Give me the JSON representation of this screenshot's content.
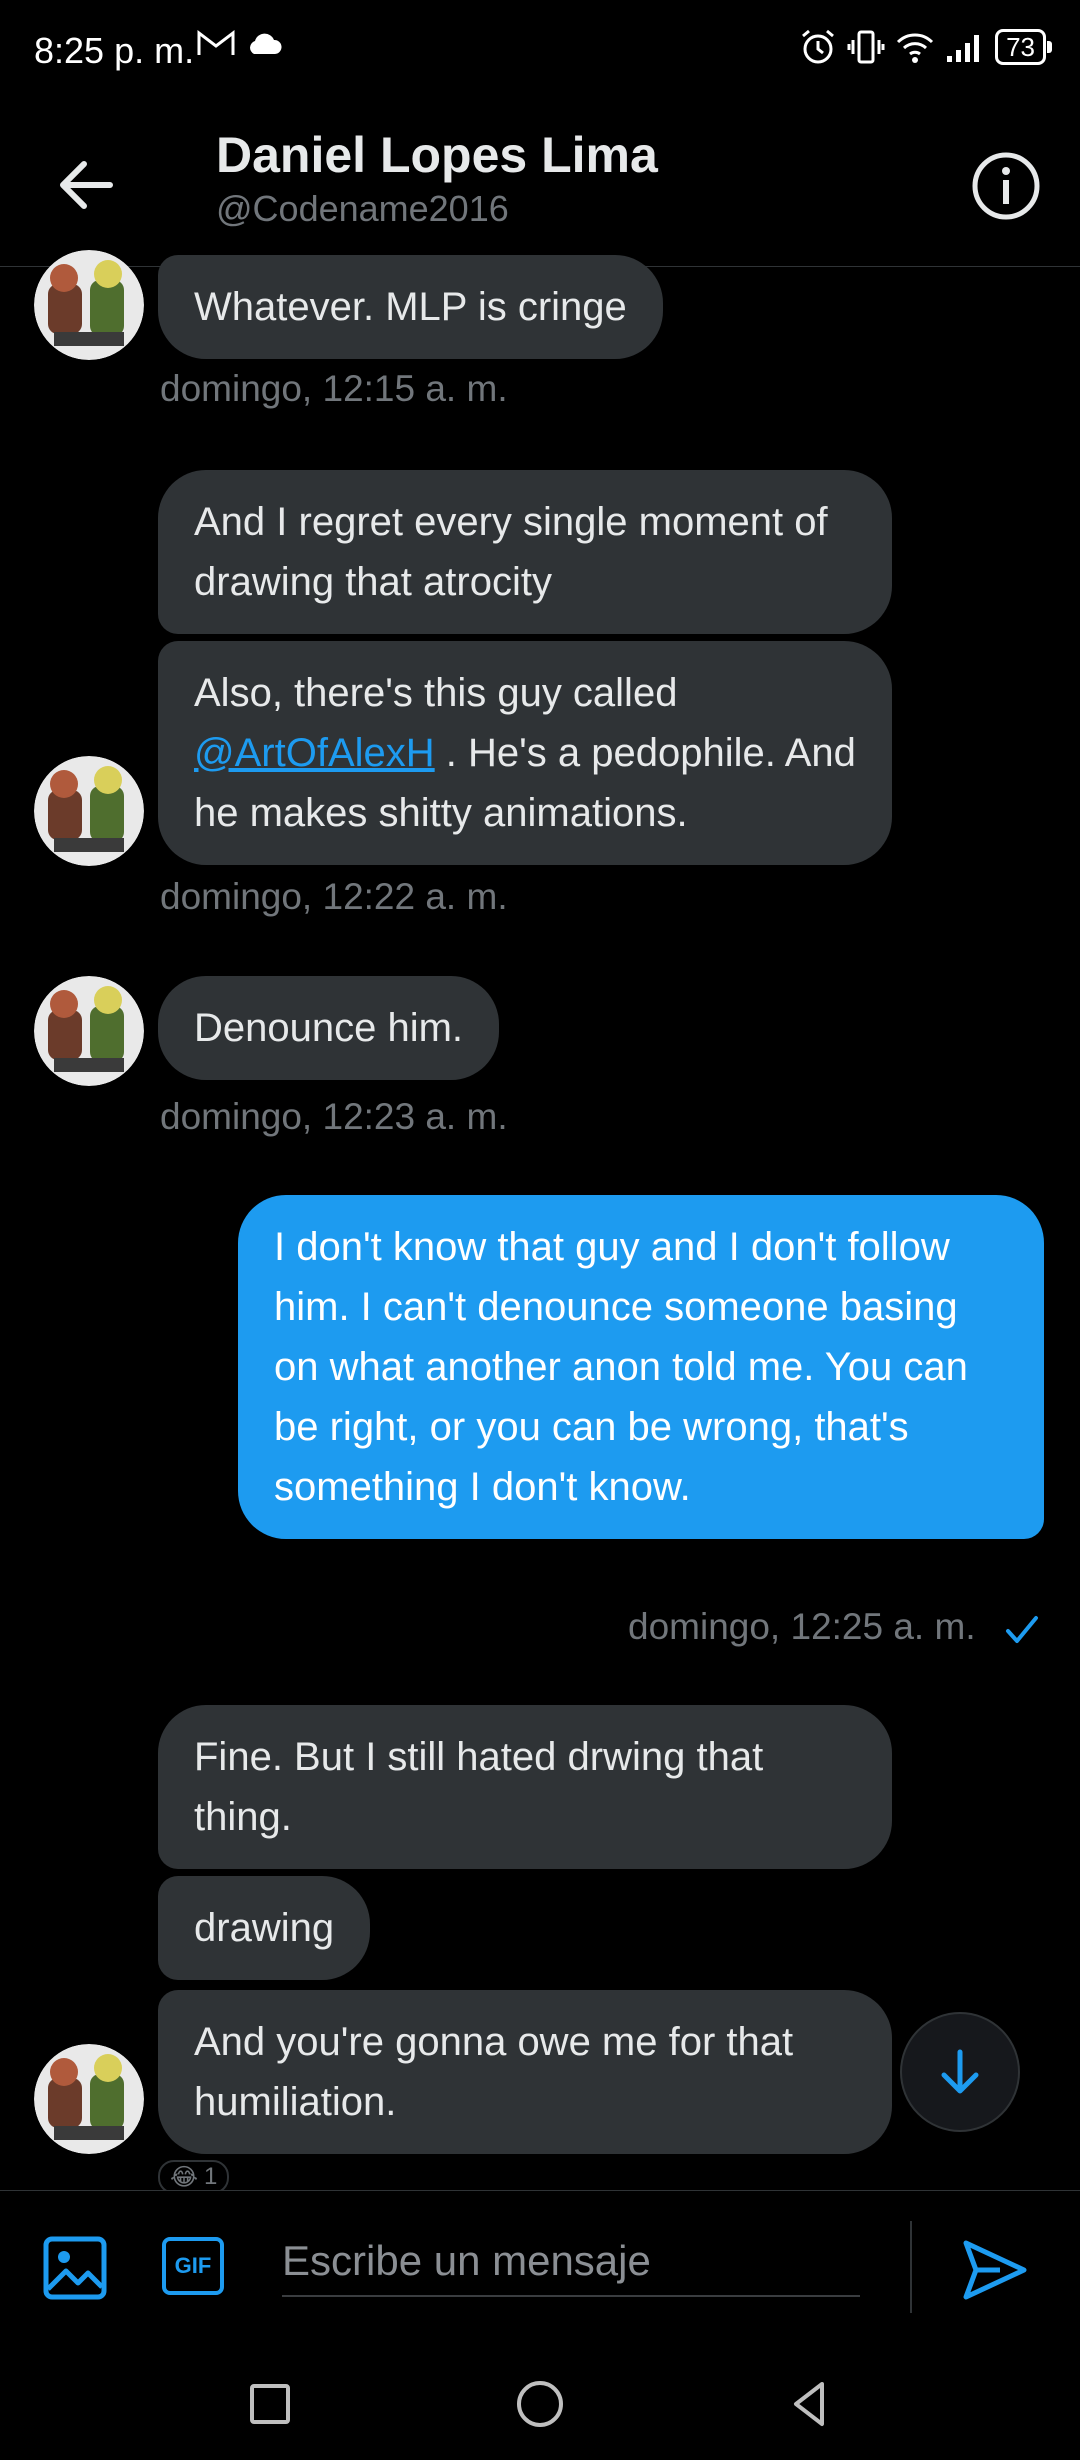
{
  "status_bar": {
    "time": "8:25 p. m.",
    "battery": "73",
    "icons": [
      "gmail-icon",
      "cloud-icon",
      "alarm-icon",
      "vibrate-icon",
      "wifi-icon",
      "signal-icon"
    ]
  },
  "header": {
    "name": "Daniel Lopes Lima",
    "handle": "@Codename2016"
  },
  "messages": [
    {
      "text": "Whatever. MLP is cringe"
    },
    {
      "text": "domingo, 12:15 a. m."
    },
    {
      "text": "And I regret every single moment of drawing that atrocity"
    },
    {
      "before": "Also, there's this guy called ",
      "mention": "@ArtOfAlexH",
      "after": " . He's a pedophile. And he makes shitty animations."
    },
    {
      "text": "domingo, 12:22 a. m."
    },
    {
      "text": "Denounce him."
    },
    {
      "text": "domingo, 12:23 a. m."
    },
    {
      "text": "I don't know that guy and I don't follow him. I can't denounce someone basing on what another anon told me. You can be right, or you can be wrong, that's something I don't know."
    },
    {
      "text": "domingo, 12:25 a. m."
    },
    {
      "text": "Fine. But I still hated drwing that thing."
    },
    {
      "text": "drawing"
    },
    {
      "text": "And you're gonna owe me for that humiliation."
    }
  ],
  "reaction": {
    "emoji": "😂",
    "count": "1"
  },
  "composer": {
    "placeholder": "Escribe un mensaje",
    "gif_label": "GIF"
  },
  "colors": {
    "accent": "#1d9bf0",
    "bubble_in": "#2f3336",
    "background": "#000000",
    "muted": "#71767b"
  }
}
